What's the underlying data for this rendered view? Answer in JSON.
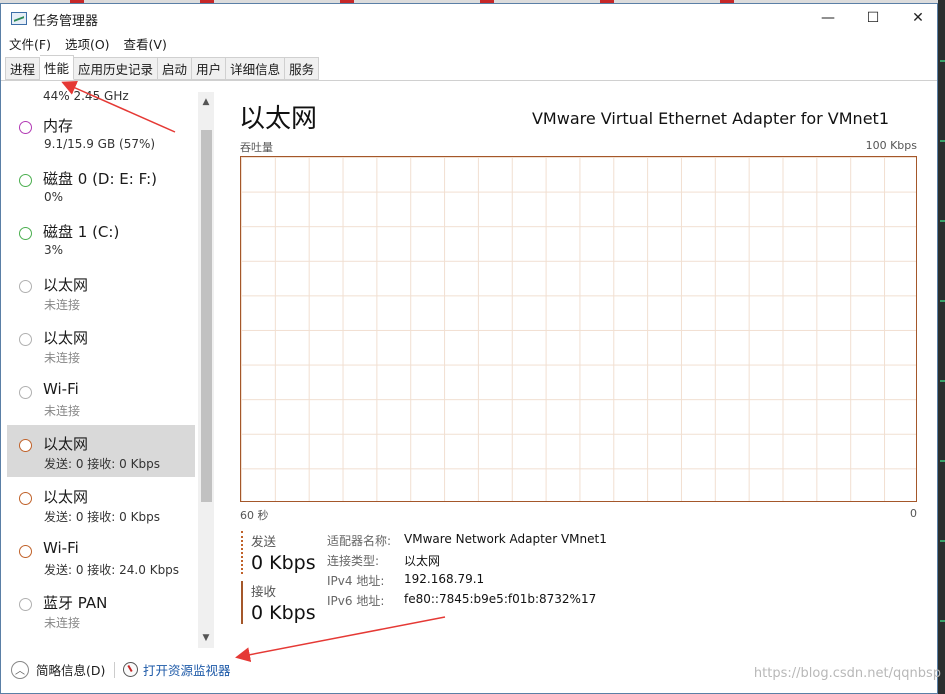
{
  "window": {
    "title": "任务管理器",
    "controls": {
      "minimize": "—",
      "maximize": "☐",
      "close": "✕"
    }
  },
  "menu": [
    "文件(F)",
    "选项(O)",
    "查看(V)"
  ],
  "tabs": [
    {
      "label": "进程",
      "active": false
    },
    {
      "label": "性能",
      "active": true
    },
    {
      "label": "应用历史记录",
      "active": false
    },
    {
      "label": "启动",
      "active": false
    },
    {
      "label": "用户",
      "active": false
    },
    {
      "label": "详细信息",
      "active": false
    },
    {
      "label": "服务",
      "active": false
    }
  ],
  "sidebar": {
    "partial_top": "44%  2.45 GHz",
    "items": [
      {
        "name": "内存",
        "sub": "9.1/15.9 GB (57%)",
        "color": "#b23ab5",
        "muted": false,
        "selected": false
      },
      {
        "name": "磁盘 0 (D: E: F:)",
        "sub": "0%",
        "color": "#4caf50",
        "muted": false,
        "selected": false
      },
      {
        "name": "磁盘 1 (C:)",
        "sub": "3%",
        "color": "#4caf50",
        "muted": false,
        "selected": false
      },
      {
        "name": "以太网",
        "sub": "未连接",
        "color": "#b0b0b0",
        "muted": true,
        "selected": false
      },
      {
        "name": "以太网",
        "sub": "未连接",
        "color": "#b0b0b0",
        "muted": true,
        "selected": false
      },
      {
        "name": "Wi-Fi",
        "sub": "未连接",
        "color": "#b0b0b0",
        "muted": true,
        "selected": false
      },
      {
        "name": "以太网",
        "sub": "发送: 0 接收: 0 Kbps",
        "color": "#c0622a",
        "muted": false,
        "selected": true
      },
      {
        "name": "以太网",
        "sub": "发送: 0 接收: 0 Kbps",
        "color": "#c0622a",
        "muted": false,
        "selected": false
      },
      {
        "name": "Wi-Fi",
        "sub": "发送: 0 接收: 24.0 Kbps",
        "color": "#c0622a",
        "muted": false,
        "selected": false
      },
      {
        "name": "蓝牙 PAN",
        "sub": "未连接",
        "color": "#b0b0b0",
        "muted": true,
        "selected": false
      }
    ]
  },
  "main": {
    "title": "以太网",
    "adapter_name": "VMware Virtual Ethernet Adapter for VMnet1",
    "graph": {
      "label_top_left": "吞吐量",
      "label_top_right": "100 Kbps",
      "label_bottom_left": "60 秒",
      "label_bottom_right": "0",
      "line_color": "#a4572a"
    },
    "send": {
      "label": "发送",
      "value": "0 Kbps"
    },
    "receive": {
      "label": "接收",
      "value": "0 Kbps"
    },
    "info": [
      {
        "key": "适配器名称:",
        "value": "VMware Network Adapter VMnet1"
      },
      {
        "key": "连接类型:",
        "value": "以太网"
      },
      {
        "key": "IPv4 地址:",
        "value": "192.168.79.1"
      },
      {
        "key": "IPv6 地址:",
        "value": "fe80::7845:b9e5:f01b:8732%17"
      }
    ]
  },
  "footer": {
    "fewer_details": "简略信息(D)",
    "open_monitor": "打开资源监视器"
  },
  "watermark": "https://blog.csdn.net/qqnbsp"
}
